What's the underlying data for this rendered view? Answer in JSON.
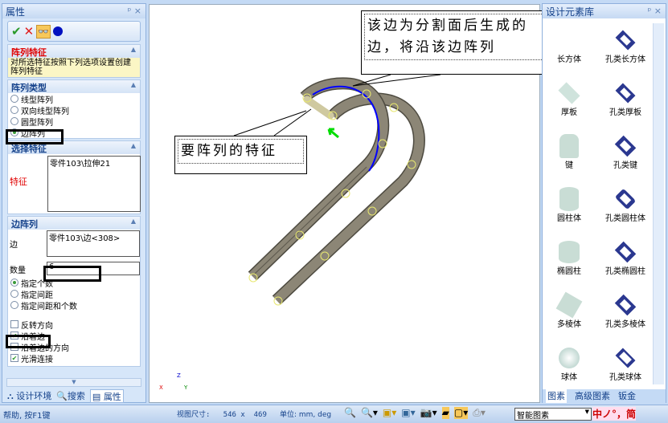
{
  "left_panel": {
    "title": "属性",
    "pin": "ᵖ",
    "close": "×",
    "sections": {
      "pattern_feature": {
        "title": "阵列特征",
        "note": "对所选特征按照下列选项设置创建阵列特征"
      },
      "pattern_type": {
        "title": "阵列类型",
        "options": [
          "线型阵列",
          "双向线型阵列",
          "圆型阵列",
          "边阵列"
        ],
        "selected": "边阵列"
      },
      "select_feature": {
        "title": "选择特征",
        "label": "特征",
        "value": "零件103\\拉伸21"
      },
      "edge_pattern": {
        "title": "边阵列",
        "edge_label": "边",
        "edge_value": "零件103\\边<308>",
        "count_label": "数量",
        "count_value": "6",
        "modes": [
          "指定个数",
          "指定间距",
          "指定间距和个数"
        ],
        "selected_mode": "指定个数",
        "checks": [
          {
            "label": "反转方向",
            "checked": false
          },
          {
            "label": "沿着边",
            "checked": true
          },
          {
            "label": "沿着边的方向",
            "checked": false
          },
          {
            "label": "光滑连接",
            "checked": true
          }
        ]
      }
    },
    "tabs": [
      "设计环境",
      "搜索",
      "属性"
    ],
    "active_tab": "属性"
  },
  "canvas": {
    "callout_top": {
      "line1": "该边为分割面后生成的",
      "line2": "边，将沿该边阵列"
    },
    "callout_left": "要阵列的特征",
    "axes": {
      "x": "X",
      "y": "Y",
      "z": "Z"
    }
  },
  "right_panel": {
    "title": "设计元素库",
    "items": [
      "长方体",
      "孔类长方体",
      "厚板",
      "孔类厚板",
      "键",
      "孔类键",
      "圆柱体",
      "孔类圆柱体",
      "椭圆柱",
      "孔类椭圆柱",
      "多棱体",
      "孔类多棱体",
      "球体",
      "孔类球体"
    ],
    "tabs": [
      "图素",
      "高级图素",
      "钣金"
    ],
    "active_tab": "图素"
  },
  "status": {
    "help": "帮助, 按F1键",
    "view_size": "视图尺寸:   546 x  469",
    "units": "单位: mm, deg",
    "search_mode": "智能图素",
    "ime": "中ノ°，简"
  },
  "colors": {
    "accent": "#15428b",
    "model": "#8c8676",
    "edge": "#0000ff"
  }
}
